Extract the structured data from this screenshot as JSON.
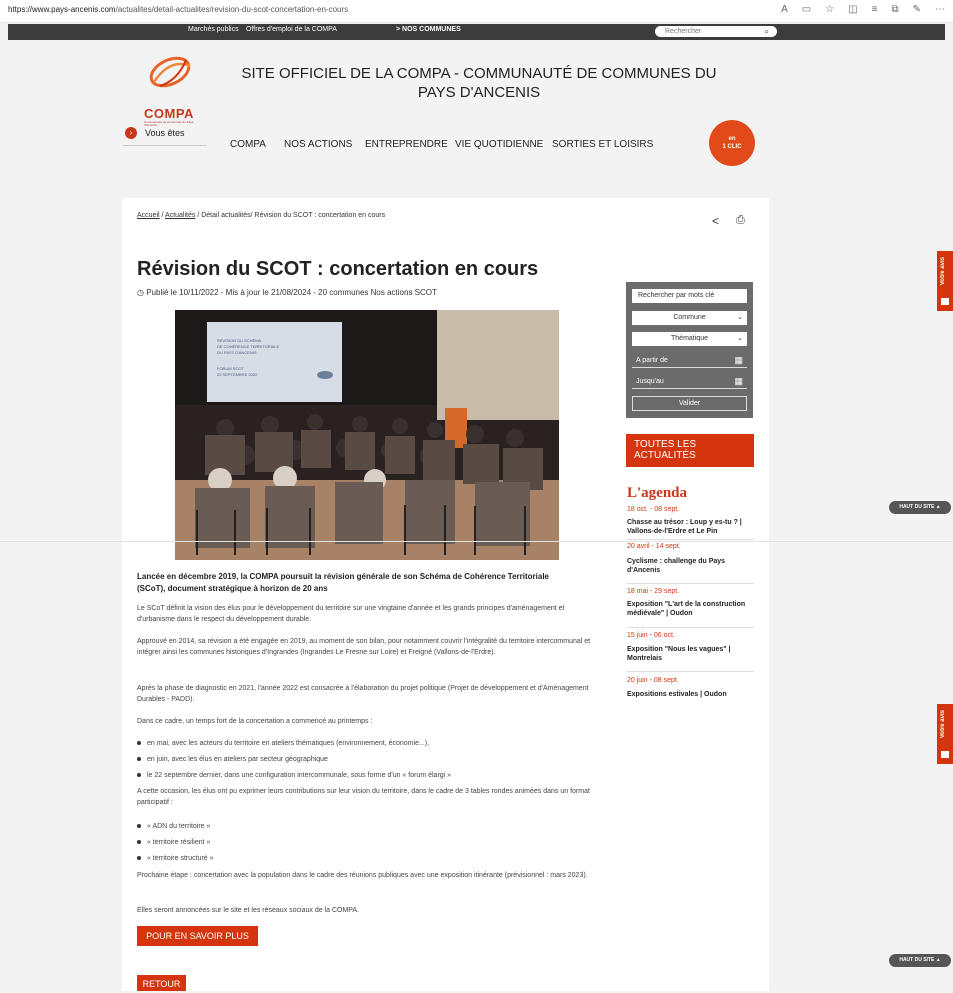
{
  "browser": {
    "url_host": "https://www.pays-ancenis.com",
    "url_path": "/actualites/detail-actualites/revision-du-scot-concertation-en-cours"
  },
  "topbar": {
    "links": [
      "Marchés publics",
      "Offres d'emploi de la COMPA"
    ],
    "communes": "> NOS COMMUNES",
    "search_placeholder": "Rechercher"
  },
  "header": {
    "logo_text": "COMPA",
    "logo_sub": "Communauté de communes du Pays d'Ancenis",
    "title": "SITE OFFICIEL DE LA COMPA - COMMUNAUTÉ DE COMMUNES DU PAYS D'ANCENIS",
    "vous_etes": "Vous êtes",
    "nav": [
      "COMPA",
      "NOS ACTIONS",
      "ENTREPRENDRE",
      "VIE QUOTIDIENNE",
      "SORTIES ET LOISIRS"
    ],
    "clic": {
      "line1": "en",
      "line2": "1 CLIC"
    }
  },
  "breadcrumb": {
    "home": "Accueil",
    "actus": "Actualités",
    "rest": "/ Détail actualités/ Révision du SCOT : concertation en cours"
  },
  "article": {
    "title": "Révision du SCOT : concertation en cours",
    "meta": "Publié le 10/11/2022 - Mis à jour le 21/08/2024 - 20 communes Nos actions SCOT",
    "lead": "Lancée en décembre 2019, la COMPA poursuit la révision générale de son Schéma de Cohérence Territoriale (SCoT), document stratégique à horizon de 20 ans",
    "p1": "Le SCoT définit la vision des élus pour le développement du territoire sur une vingtaine d'année et les grands principes d'aménagement et d'urbanisme dans le respect du développement durable.",
    "p2": "Approuvé en 2014, sa révision a été engagée en 2019, au moment de son bilan, pour notamment couvrir l'intégralité du territoire intercommunal et intégrer ainsi les communes historiques d'Ingrandes (Ingrandes Le Fresne sur Loire) et Freigné (Vallons-de-l'Erdre).",
    "p3": "Après la phase de diagnostic en 2021, l'année 2022 est consacrée à l'élaboration du projet politique (Projet de développement et d'Aménagement Durables - PADD).",
    "p4": "Dans ce cadre, un temps fort de la concertation a commencé au printemps :",
    "bullets1": [
      "en mai, avec les acteurs du territoire en ateliers thématiques (environnement, économie...),",
      "en juin, avec les élus en ateliers par secteur géographique",
      "le 22 septembre dernier, dans une configuration intercommunale, sous forme d'un « forum élargi »"
    ],
    "p5": "A cette occasion, les élus ont pu exprimer leurs contributions sur leur vision du territoire, dans le cadre de 3 tables rondes animées dans un format participatif :",
    "bullets2": [
      "« ADN du territoire »",
      "« territoire résilient »",
      "« territoire structuré »"
    ],
    "p6": "Prochaine étape : concertation avec la population dans le cadre des réunions publiques avec une exposition itinérante (prévisionnel : mars 2023).",
    "p7": "Elles seront annoncées sur le site et les réseaux sociaux de la COMPA.",
    "more_button": "POUR EN SAVOIR PLUS",
    "back_button": "RETOUR",
    "screen_text": [
      "RÉVISION DU SCHÉMA",
      "DE COHÉRENCE TERRITORIALE",
      "DU PAYS D'ANCENIS",
      "FORUM SCOT",
      "22 SEPTEMBRE 2022"
    ]
  },
  "sidebar": {
    "keyword_placeholder": "Rechercher par mots clé",
    "commune": "Commune",
    "thematique": "Thématique",
    "from": "A partir de",
    "to": "Jusqu'au",
    "validate": "Valider",
    "all_news": "TOUTES LES ACTUALITÉS",
    "agenda_title": "L'agenda",
    "events": [
      {
        "date": "18 oct. - 08 sept.",
        "title": "Chasse au trésor : Loup y es-tu ? | Vallons-de-l'Erdre et Le Pin"
      },
      {
        "date": "20 avril - 14 sept.",
        "title": "Cyclisme : challenge du Pays d'Ancenis"
      },
      {
        "date": "18 mai - 29 sept.",
        "title": "Exposition \"L'art de la construction médiévale\" | Oudon"
      },
      {
        "date": "15 juin - 06 oct.",
        "title": "Exposition \"Nous les vagues\" | Montrelais"
      },
      {
        "date": "20 juin - 08 sept.",
        "title": "Expositions estivales | Oudon"
      }
    ]
  },
  "floating": {
    "avis": "Votre avis",
    "haut": "HAUT DU SITE"
  },
  "colors": {
    "accent": "#d4350e",
    "dark_bar": "#3c3c3c",
    "form_bg": "#6b6b6b"
  }
}
